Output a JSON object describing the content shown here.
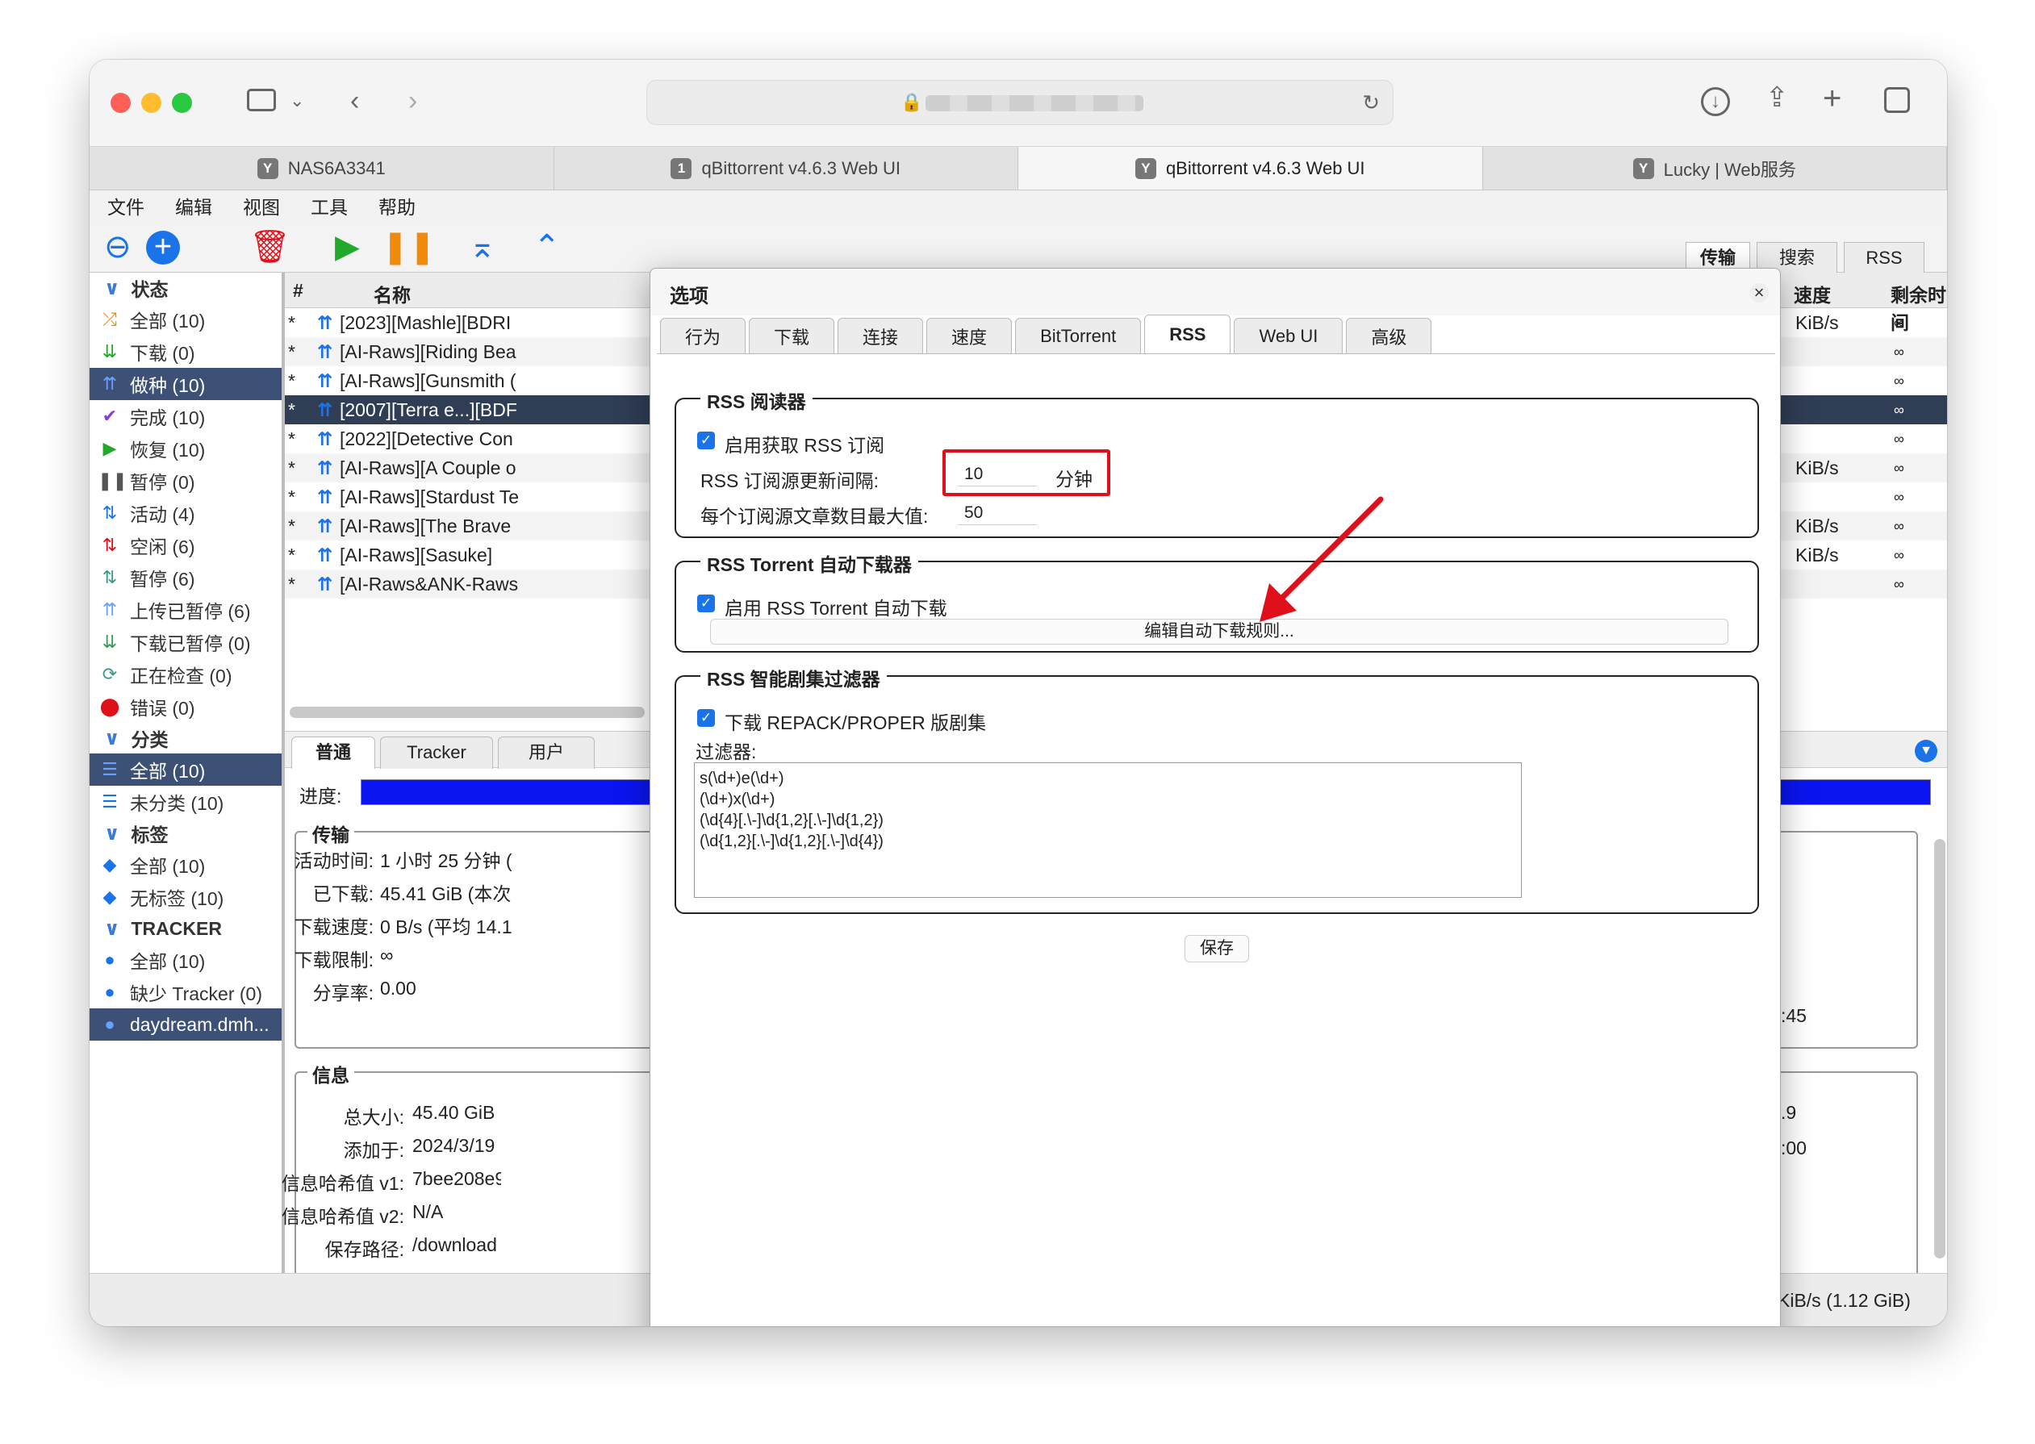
{
  "tabs": [
    {
      "fav": "Y",
      "label": "NAS6A3341"
    },
    {
      "fav": "1",
      "label": "qBittorrent v4.6.3 Web UI"
    },
    {
      "fav": "Y",
      "label": "qBittorrent v4.6.3 Web UI"
    },
    {
      "fav": "Y",
      "label": "Lucky | Web服务"
    }
  ],
  "menu": [
    "文件",
    "编辑",
    "视图",
    "工具",
    "帮助"
  ],
  "sidebar": {
    "status_header": "状态",
    "status": [
      "全部 (10)",
      "下载 (0)",
      "做种 (10)",
      "完成 (10)",
      "恢复 (10)",
      "暂停 (0)",
      "活动 (4)",
      "空闲 (6)",
      "暂停 (6)",
      "上传已暂停 (6)",
      "下载已暂停 (0)",
      "正在检查 (0)",
      "错误 (0)"
    ],
    "category_header": "分类",
    "categories": [
      "全部 (10)",
      "未分类 (10)"
    ],
    "tag_header": "标签",
    "tags": [
      "全部 (10)",
      "无标签 (10)"
    ],
    "tracker_header": "TRACKER",
    "trackers": [
      "全部 (10)",
      "缺少 Tracker (0)",
      "daydream.dmh..."
    ]
  },
  "table": {
    "col_num": "#",
    "col_name": "名称",
    "col_speed": "速度",
    "col_eta": "剩余时间",
    "rows": [
      {
        "n": "*",
        "name": "[2023][Mashle][BDRI",
        "speed": "KiB/s",
        "eta": "∞"
      },
      {
        "n": "*",
        "name": "[AI-Raws][Riding Bea",
        "speed": "",
        "eta": "∞"
      },
      {
        "n": "*",
        "name": "[AI-Raws][Gunsmith (",
        "speed": "",
        "eta": "∞"
      },
      {
        "n": "*",
        "name": "[2007][Terra e...][BDF",
        "speed": "",
        "eta": "∞"
      },
      {
        "n": "*",
        "name": "[2022][Detective Con",
        "speed": "",
        "eta": "∞"
      },
      {
        "n": "*",
        "name": "[AI-Raws][A Couple o",
        "speed": "KiB/s",
        "eta": "∞"
      },
      {
        "n": "*",
        "name": "[AI-Raws][Stardust Te",
        "speed": "",
        "eta": "∞"
      },
      {
        "n": "*",
        "name": "[AI-Raws][The Brave",
        "speed": "KiB/s",
        "eta": "∞"
      },
      {
        "n": "*",
        "name": "[AI-Raws][Sasuke]",
        "speed": "KiB/s",
        "eta": "∞"
      },
      {
        "n": "*",
        "name": "[AI-Raws&ANK-Raws",
        "speed": "",
        "eta": "∞"
      }
    ]
  },
  "right_tabs": [
    "传输",
    "搜索",
    "RSS"
  ],
  "detail_tabs": [
    "普通",
    "Tracker",
    "用户"
  ],
  "detail": {
    "progress_label": "进度:",
    "transfer_legend": "传输",
    "transfer": [
      {
        "k": "活动时间:",
        "v": "1 小时 25 分钟 ("
      },
      {
        "k": "已下载:",
        "v": "45.41 GiB (本次"
      },
      {
        "k": "下载速度:",
        "v": "0 B/s (平均 14.1"
      },
      {
        "k": "下载限制:",
        "v": "∞"
      },
      {
        "k": "分享率:",
        "v": "0.00"
      }
    ],
    "transfer_right": ":45",
    "info_legend": "信息",
    "info": [
      {
        "k": "总大小:",
        "v": "45.40 GiB"
      },
      {
        "k": "添加于:",
        "v": "2024/3/19"
      },
      {
        "k": "信息哈希值 v1:",
        "v": "7bee208e9"
      },
      {
        "k": "信息哈希值 v2:",
        "v": "N/A"
      },
      {
        "k": "保存路径:",
        "v": "/download"
      }
    ],
    "info_right1": ".9",
    "info_right2": ":00"
  },
  "statusbar": {
    "right": "KiB/s (1.12 GiB)"
  },
  "dialog": {
    "title": "选项",
    "close": "×",
    "tabs": [
      "行为",
      "下载",
      "连接",
      "速度",
      "BitTorrent",
      "RSS",
      "Web UI",
      "高级"
    ],
    "active_tab": "RSS",
    "reader": {
      "legend": "RSS 阅读器",
      "enable_label": "启用获取 RSS 订阅",
      "interval_label": "RSS 订阅源更新间隔:",
      "interval_value": "10",
      "interval_unit": "分钟",
      "max_label": "每个订阅源文章数目最大值:",
      "max_value": "50"
    },
    "downloader": {
      "legend": "RSS Torrent 自动下载器",
      "enable_label": "启用 RSS Torrent 自动下载",
      "edit_button": "编辑自动下载规则..."
    },
    "filter": {
      "legend": "RSS 智能剧集过滤器",
      "repack_label": "下载 REPACK/PROPER 版剧集",
      "filter_label": "过滤器:",
      "filter_text": "s(\\d+)e(\\d+)\n(\\d+)x(\\d+)\n(\\d{4}[.\\-]\\d{1,2}[.\\-]\\d{1,2})\n(\\d{1,2}[.\\-]\\d{1,2}[.\\-]\\d{4})"
    },
    "save_button": "保存"
  },
  "colors": {
    "accent": "#1a73e8",
    "selected": "#3d5177",
    "highlight": "#e0101a",
    "progress": "#0a14f0"
  }
}
